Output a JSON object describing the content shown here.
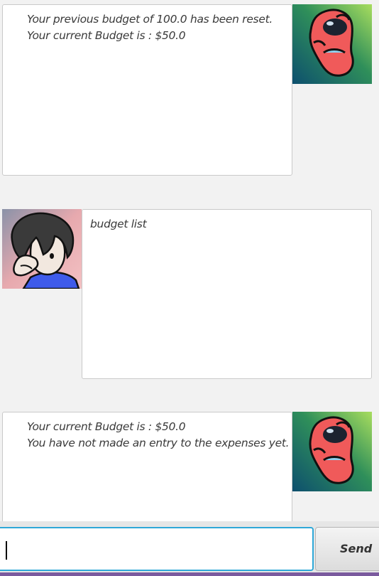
{
  "messages": [
    {
      "sender": "bot",
      "avatar_icon": "red-blob-bot-icon",
      "text": "Your previous budget of 100.0 has been reset.\nYour current Budget is : $50.0"
    },
    {
      "sender": "user",
      "avatar_icon": "user-cartoon-avatar-icon",
      "text": "budget list"
    },
    {
      "sender": "bot",
      "avatar_icon": "red-blob-bot-icon",
      "text": "Your current Budget is : $50.0\nYou have not made an entry to the expenses yet."
    }
  ],
  "input": {
    "value": "",
    "placeholder": ""
  },
  "send_button": {
    "label": "Send"
  },
  "colors": {
    "input_focus_border": "#2fa8d8",
    "bot_avatar_bg_start": "#0d4f6e",
    "bot_avatar_bg_end": "#8fd35a",
    "bot_blob": "#f05a5a",
    "user_avatar_bg": "#e9a1a6",
    "user_shirt": "#3f5bea"
  }
}
